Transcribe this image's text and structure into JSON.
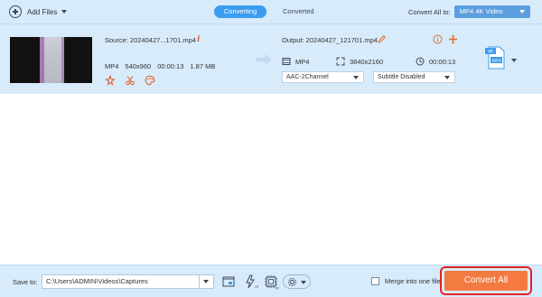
{
  "toolbar": {
    "add_files_label": "Add Files",
    "tabs": [
      {
        "label": "Converting",
        "active": true
      },
      {
        "label": "Converted",
        "active": false
      }
    ],
    "convert_all_to_label": "Convert All to:",
    "convert_all_to_value": "MP4 4K Video"
  },
  "file": {
    "source_label": "Source: 20240427...1701.mp4",
    "format": "MP4",
    "resolution": "540x960",
    "duration": "00:00:13",
    "size": "1.87 MB",
    "output_label": "Output: 20240427_121701.mp4",
    "output_format": "MP4",
    "output_resolution": "3840x2160",
    "output_duration": "00:00:13",
    "audio_track": "AAC-2Channel",
    "subtitle": "Subtitle Disabled",
    "format_badge_top": "4K",
    "format_badge_bottom": "MP4"
  },
  "bottom": {
    "save_to_label": "Save to:",
    "save_path": "C:\\Users\\ADMIN\\Videos\\Captures",
    "merge_label": "Merge into one file",
    "merge_checked": false,
    "convert_all_label": "Convert All"
  },
  "colors": {
    "toolbar_bg": "#d8ebfa",
    "accent_blue": "#3c9cf0",
    "convert_orange": "#f37a41",
    "highlight_red": "#e22222"
  }
}
